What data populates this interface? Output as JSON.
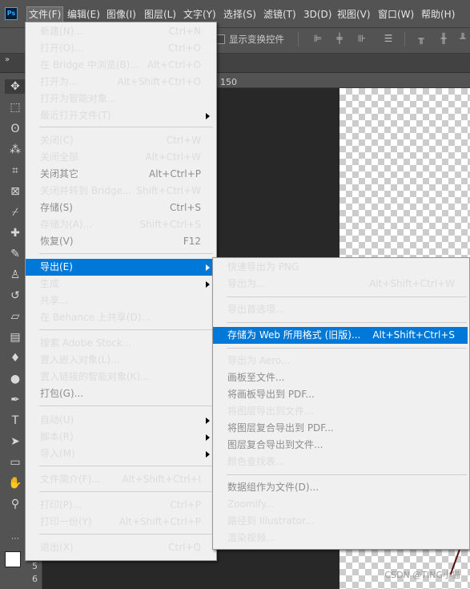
{
  "menubar": {
    "logo": "Ps",
    "items": [
      "文件(F)",
      "编辑(E)",
      "图像(I)",
      "图层(L)",
      "文字(Y)",
      "选择(S)",
      "滤镜(T)",
      "3D(D)",
      "视图(V)",
      "窗口(W)",
      "帮助(H)"
    ]
  },
  "options": {
    "show_transform": "显示变换控件"
  },
  "tabstrip": {
    "collapse": "»"
  },
  "ruler": {
    "h_label": "150",
    "v_labels": [
      "5",
      "6"
    ]
  },
  "watermark": "CSDN @TING小猫",
  "file_menu": {
    "items": [
      {
        "label": "新建(N)...",
        "shortcut": "Ctrl+N"
      },
      {
        "label": "打开(O)...",
        "shortcut": "Ctrl+O"
      },
      {
        "label": "在 Bridge 中浏览(B)...",
        "shortcut": "Alt+Ctrl+O"
      },
      {
        "label": "打开为...",
        "shortcut": "Alt+Shift+Ctrl+O"
      },
      {
        "label": "打开为智能对象...",
        "shortcut": ""
      },
      {
        "label": "最近打开文件(T)",
        "shortcut": ""
      },
      {
        "label": "关闭(C)",
        "shortcut": "Ctrl+W"
      },
      {
        "label": "关闭全部",
        "shortcut": "Alt+Ctrl+W"
      },
      {
        "label": "关闭其它",
        "shortcut": "Alt+Ctrl+P"
      },
      {
        "label": "关闭并转到 Bridge...",
        "shortcut": "Shift+Ctrl+W"
      },
      {
        "label": "存储(S)",
        "shortcut": "Ctrl+S"
      },
      {
        "label": "存储为(A)...",
        "shortcut": "Shift+Ctrl+S"
      },
      {
        "label": "恢复(V)",
        "shortcut": "F12"
      },
      {
        "label": "导出(E)",
        "shortcut": ""
      },
      {
        "label": "生成",
        "shortcut": ""
      },
      {
        "label": "共享...",
        "shortcut": ""
      },
      {
        "label": "在 Behance 上共享(D)...",
        "shortcut": ""
      },
      {
        "label": "搜索 Adobe Stock...",
        "shortcut": ""
      },
      {
        "label": "置入嵌入对象(L)...",
        "shortcut": ""
      },
      {
        "label": "置入链接的智能对象(K)...",
        "shortcut": ""
      },
      {
        "label": "打包(G)...",
        "shortcut": ""
      },
      {
        "label": "自动(U)",
        "shortcut": ""
      },
      {
        "label": "脚本(R)",
        "shortcut": ""
      },
      {
        "label": "导入(M)",
        "shortcut": ""
      },
      {
        "label": "文件简介(F)...",
        "shortcut": "Alt+Shift+Ctrl+I"
      },
      {
        "label": "打印(P)...",
        "shortcut": "Ctrl+P"
      },
      {
        "label": "打印一份(Y)",
        "shortcut": "Alt+Shift+Ctrl+P"
      },
      {
        "label": "退出(X)",
        "shortcut": "Ctrl+Q"
      }
    ]
  },
  "export_menu": {
    "items": [
      {
        "label": "快速导出为 PNG",
        "shortcut": ""
      },
      {
        "label": "导出为...",
        "shortcut": "Alt+Shift+Ctrl+W"
      },
      {
        "label": "导出首选项...",
        "shortcut": ""
      },
      {
        "label": "存储为 Web 所用格式 (旧版)...",
        "shortcut": "Alt+Shift+Ctrl+S"
      },
      {
        "label": "导出为 Aero...",
        "shortcut": ""
      },
      {
        "label": "画板至文件...",
        "shortcut": ""
      },
      {
        "label": "将画板导出到 PDF...",
        "shortcut": ""
      },
      {
        "label": "将图层导出到文件...",
        "shortcut": ""
      },
      {
        "label": "将图层复合导出到 PDF...",
        "shortcut": ""
      },
      {
        "label": "图层复合导出到文件...",
        "shortcut": ""
      },
      {
        "label": "颜色查找表...",
        "shortcut": ""
      },
      {
        "label": "数据组作为文件(D)...",
        "shortcut": ""
      },
      {
        "label": "Zoomify...",
        "shortcut": ""
      },
      {
        "label": "路径到 Illustrator...",
        "shortcut": ""
      },
      {
        "label": "渲染视频...",
        "shortcut": ""
      }
    ]
  }
}
